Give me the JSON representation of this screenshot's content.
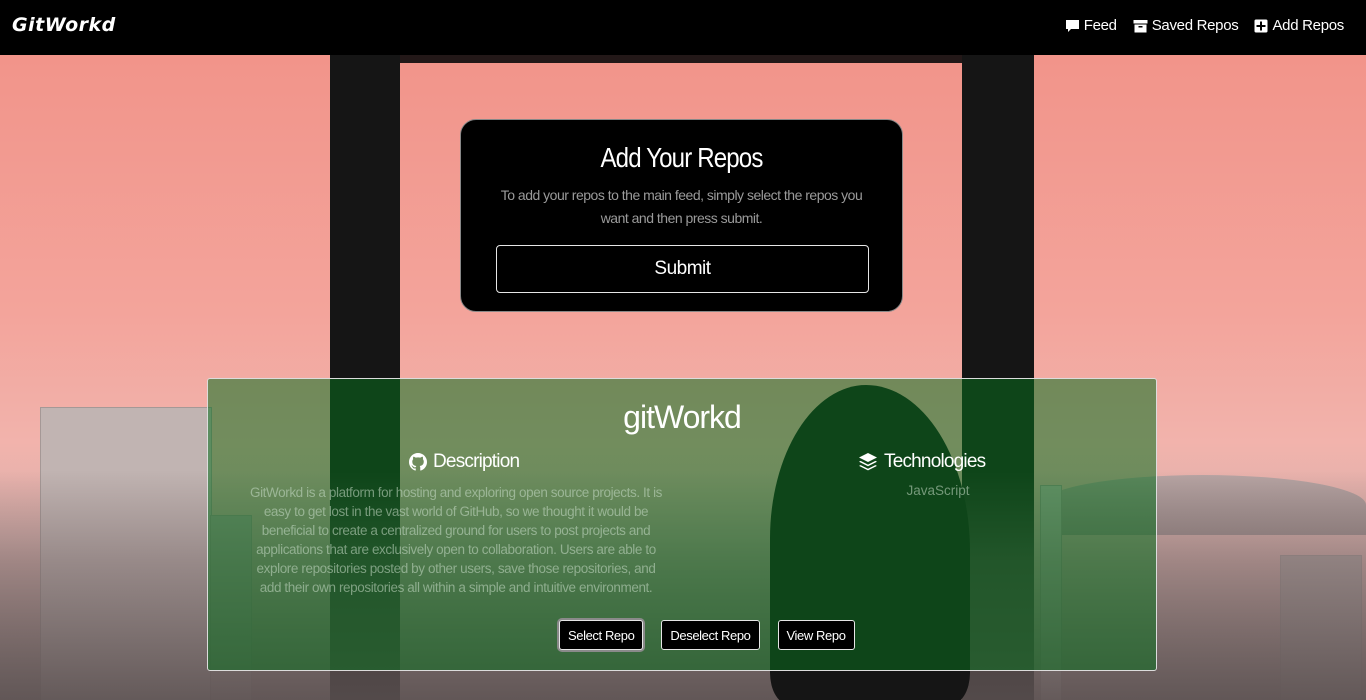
{
  "navbar": {
    "brand": "GitWorkd",
    "links": [
      {
        "label": "Feed",
        "icon": "comment-icon"
      },
      {
        "label": "Saved Repos",
        "icon": "archive-icon"
      },
      {
        "label": "Add Repos",
        "icon": "plus-square-icon"
      }
    ]
  },
  "submit_card": {
    "title": "Add Your Repos",
    "instructions": "To add your repos to the main feed, simply select the repos you want and then press submit.",
    "submit_label": "Submit"
  },
  "repo": {
    "name": "gitWorkd",
    "description_heading": "Description",
    "description_icon": "github-icon",
    "description": "GitWorkd is a platform for hosting and exploring open source projects. It is easy to get lost in the vast world of GitHub, so we thought it would be beneficial to create a centralized ground for users to post projects and applications that are exclusively open to collaboration. Users are able to explore repositories posted by other users, save those repositories, and add their own repositories all within a simple and intuitive environment.",
    "technologies_heading": "Technologies",
    "technologies_icon": "layers-icon",
    "technologies": "JavaScript",
    "buttons": {
      "select": "Select Repo",
      "deselect": "Deselect Repo",
      "view": "View Repo"
    }
  },
  "colors": {
    "navbar_bg": "#000000",
    "card_bg": "#000000",
    "repo_overlay": "#0a6e1e",
    "text": "#ffffff"
  }
}
